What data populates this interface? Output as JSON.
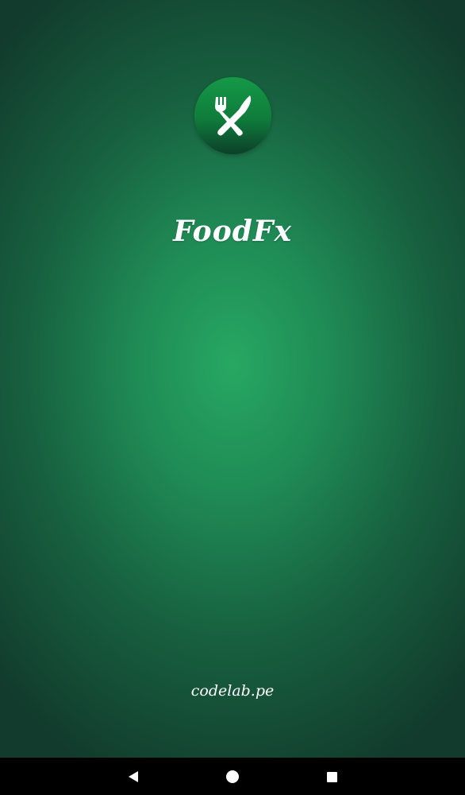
{
  "app": {
    "title": "FoodFx",
    "logo_icon": "fork-knife-icon",
    "footer": "codelab.pe"
  },
  "colors": {
    "background_center": "#27a862",
    "background_edge": "#123b2d",
    "logo_green": "#159947",
    "text": "#ffffff",
    "navbar": "#000000"
  },
  "navbar": {
    "back_icon": "back-triangle-icon",
    "home_icon": "home-circle-icon",
    "recents_icon": "recents-square-icon"
  }
}
